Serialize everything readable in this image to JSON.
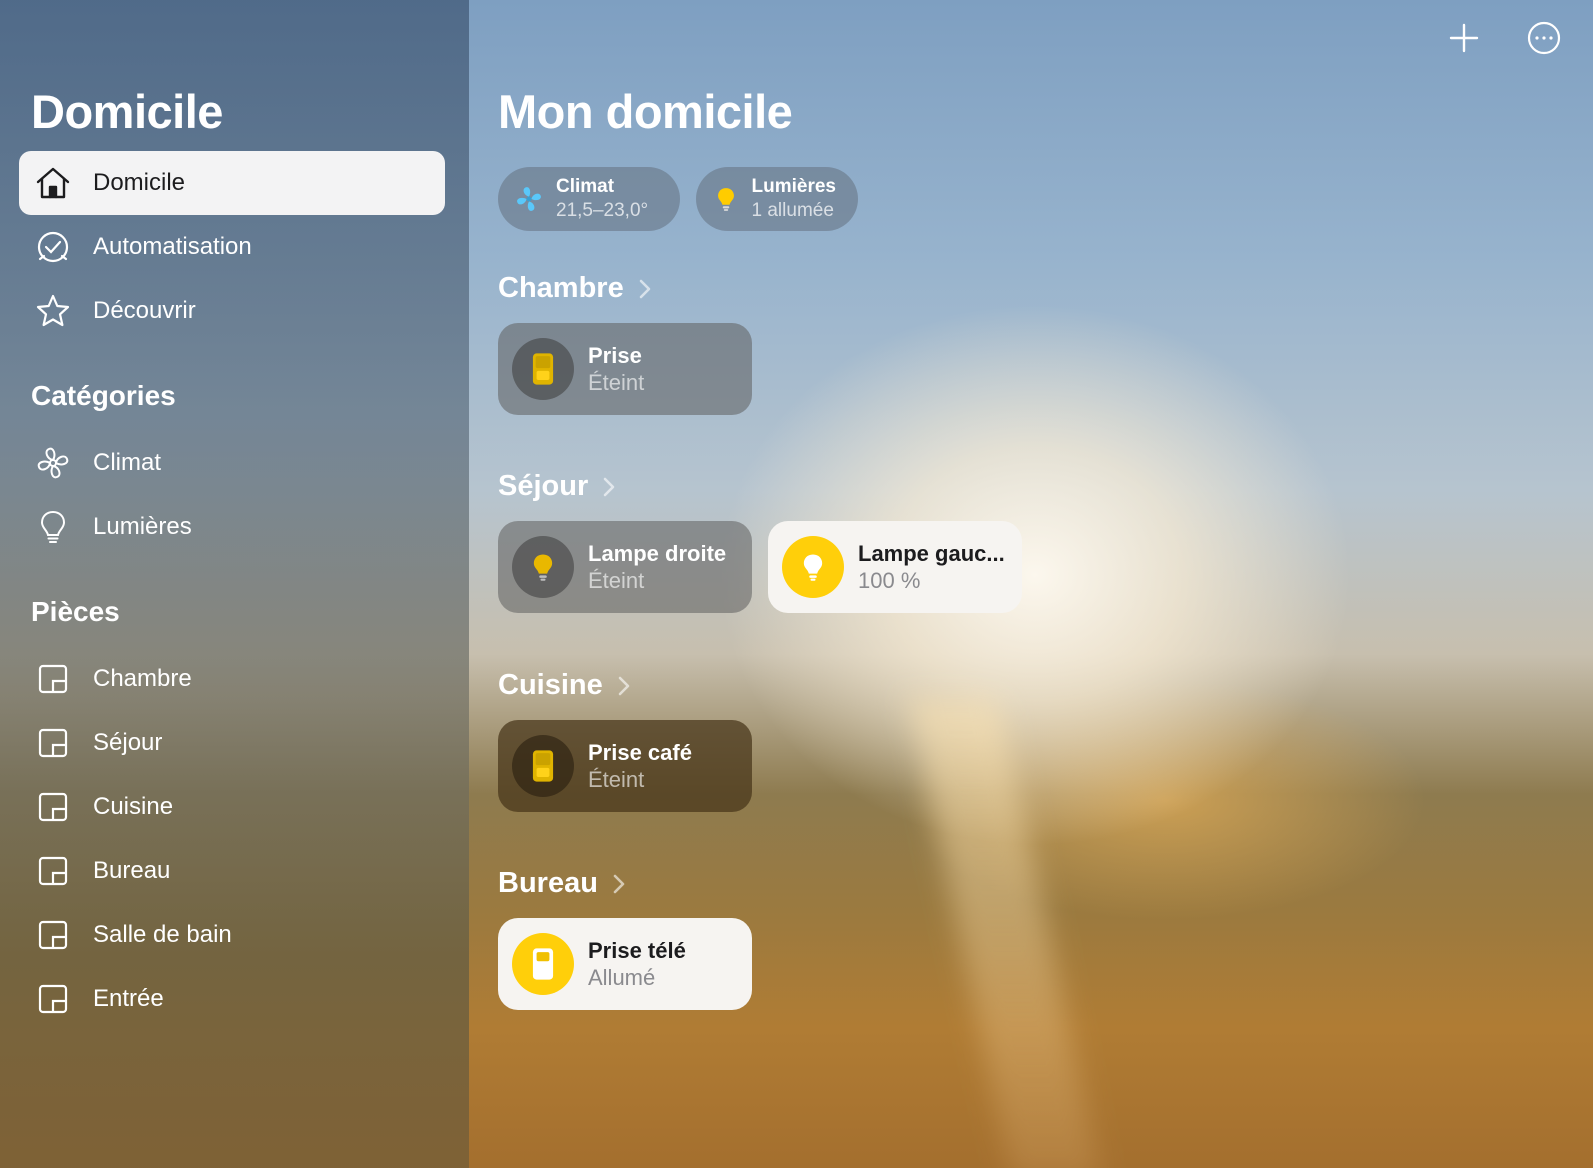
{
  "sidebar": {
    "title": "Domicile",
    "nav": [
      {
        "label": "Domicile",
        "icon": "house-icon",
        "selected": true
      },
      {
        "label": "Automatisation",
        "icon": "clock-icon",
        "selected": false
      },
      {
        "label": "Découvrir",
        "icon": "star-icon",
        "selected": false
      }
    ],
    "categories_heading": "Catégories",
    "categories": [
      {
        "label": "Climat",
        "icon": "fan-icon"
      },
      {
        "label": "Lumières",
        "icon": "lightbulb-icon"
      }
    ],
    "rooms_heading": "Pièces",
    "rooms": [
      {
        "label": "Chambre",
        "icon": "room-icon"
      },
      {
        "label": "Séjour",
        "icon": "room-icon"
      },
      {
        "label": "Cuisine",
        "icon": "room-icon"
      },
      {
        "label": "Bureau",
        "icon": "room-icon"
      },
      {
        "label": "Salle de bain",
        "icon": "room-icon"
      },
      {
        "label": "Entrée",
        "icon": "room-icon"
      }
    ]
  },
  "toolbar": {
    "add_icon": "plus-icon",
    "more_icon": "ellipsis-circle-icon"
  },
  "main": {
    "title": "Mon domicile",
    "status_pills": [
      {
        "title": "Climat",
        "subtitle": "21,5–23,0°",
        "icon": "fan-icon",
        "color": "#5ac8fa"
      },
      {
        "title": "Lumières",
        "subtitle": "1 allumée",
        "icon": "lightbulb-icon",
        "color": "#ffcc00"
      }
    ],
    "sections": [
      {
        "room": "Chambre",
        "accessories": [
          {
            "name": "Prise",
            "status": "Éteint",
            "icon": "outlet-icon",
            "on": false
          }
        ]
      },
      {
        "room": "Séjour",
        "accessories": [
          {
            "name": "Lampe droite",
            "status": "Éteint",
            "icon": "lightbulb-icon",
            "on": false
          },
          {
            "name": "Lampe gauc...",
            "status": "100 %",
            "icon": "lightbulb-icon",
            "on": true
          }
        ]
      },
      {
        "room": "Cuisine",
        "accessories": [
          {
            "name": "Prise café",
            "status": "Éteint",
            "icon": "outlet-icon",
            "on": false
          }
        ]
      },
      {
        "room": "Bureau",
        "accessories": [
          {
            "name": "Prise télé",
            "status": "Allumé",
            "icon": "outlet-icon",
            "on": true
          }
        ]
      }
    ]
  },
  "colors": {
    "accent_on": "#ffcf0a",
    "tile_on_bg": "#f6f4f1"
  }
}
